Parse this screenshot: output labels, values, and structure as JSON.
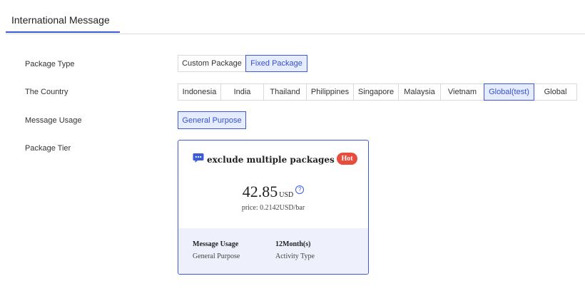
{
  "tabs": {
    "active": "International Message"
  },
  "form": {
    "package_type": {
      "label": "Package Type",
      "options": [
        "Custom Package",
        "Fixed Package"
      ],
      "selected": "Fixed Package"
    },
    "country": {
      "label": "The Country",
      "options": [
        "Indonesia",
        "India",
        "Thailand",
        "Philippines",
        "Singapore",
        "Malaysia",
        "Vietnam",
        "Global(test)",
        "Global"
      ],
      "selected": "Global(test)"
    },
    "message_usage": {
      "label": "Message Usage",
      "options": [
        "General Purpose"
      ],
      "selected": "General Purpose"
    },
    "package_tier": {
      "label": "Package Tier"
    }
  },
  "package_card": {
    "icon": "chat-bubble-icon",
    "title": "exclude multiple packages",
    "badge": "Hot",
    "price": "42.85",
    "currency": "USD",
    "help_icon": "question-circle-icon",
    "unit_price": "price: 0.2142USD/bar",
    "details": [
      {
        "label": "Message Usage",
        "value": "General Purpose"
      },
      {
        "label": "12Month(s)",
        "value": "Activity Type"
      }
    ]
  },
  "colors": {
    "accent": "#3b5bdb",
    "hot": "#e74c3c",
    "active_bg": "#e6ecff"
  }
}
